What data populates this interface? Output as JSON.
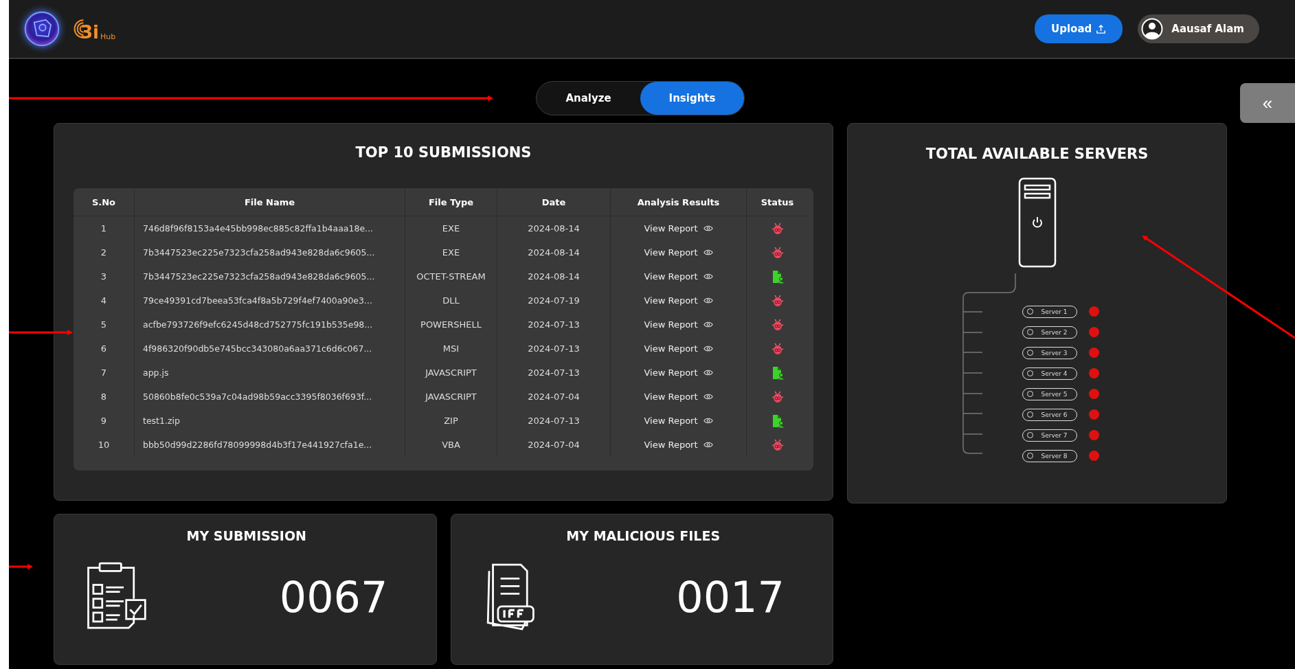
{
  "header": {
    "brand": "3i",
    "brand_sub": "Hub",
    "upload_button": "Upload",
    "user_name": "Aausaf Alam"
  },
  "tabs": [
    {
      "label": "Analyze",
      "selected": false
    },
    {
      "label": "Insights",
      "selected": true
    }
  ],
  "collapse_button": "«",
  "submissions": {
    "title": "TOP 10 SUBMISSIONS",
    "columns": [
      "S.No",
      "File Name",
      "File Type",
      "Date",
      "Analysis Results",
      "Status"
    ],
    "rows": [
      {
        "sno": "1",
        "file_name": "746d8f96f8153a4e45bb998ec885c82ffa1b4aaa18e...",
        "file_type": "EXE",
        "date": "2024-08-14",
        "result": "View Report",
        "kind": "malicious"
      },
      {
        "sno": "2",
        "file_name": "7b3447523ec225e7323cfa258ad943e828da6c9605...",
        "file_type": "EXE",
        "date": "2024-08-14",
        "result": "View Report",
        "kind": "malicious"
      },
      {
        "sno": "3",
        "file_name": "7b3447523ec225e7323cfa258ad943e828da6c9605...",
        "file_type": "OCTET-STREAM",
        "date": "2024-08-14",
        "result": "View Report",
        "kind": "clean"
      },
      {
        "sno": "4",
        "file_name": "79ce49391cd7beea53fca4f8a5b729f4ef7400a90e3...",
        "file_type": "DLL",
        "date": "2024-07-19",
        "result": "View Report",
        "kind": "malicious"
      },
      {
        "sno": "5",
        "file_name": "acfbe793726f9efc6245d48cd752775fc191b535e98...",
        "file_type": "POWERSHELL",
        "date": "2024-07-13",
        "result": "View Report",
        "kind": "malicious"
      },
      {
        "sno": "6",
        "file_name": "4f986320f90db5e745bcc343080a6aa371c6d6c067...",
        "file_type": "MSI",
        "date": "2024-07-13",
        "result": "View Report",
        "kind": "malicious"
      },
      {
        "sno": "7",
        "file_name": "app.js",
        "file_type": "JAVASCRIPT",
        "date": "2024-07-13",
        "result": "View Report",
        "kind": "clean"
      },
      {
        "sno": "8",
        "file_name": "50860b8fe0c539a7c04ad98b59acc3395f8036f693f...",
        "file_type": "JAVASCRIPT",
        "date": "2024-07-04",
        "result": "View Report",
        "kind": "malicious"
      },
      {
        "sno": "9",
        "file_name": "test1.zip",
        "file_type": "ZIP",
        "date": "2024-07-13",
        "result": "View Report",
        "kind": "clean"
      },
      {
        "sno": "10",
        "file_name": "bbb50d99d2286fd78099998d4b3f17e441927cfa1e...",
        "file_type": "VBA",
        "date": "2024-07-04",
        "result": "View Report",
        "kind": "malicious"
      }
    ]
  },
  "servers": {
    "title": "TOTAL AVAILABLE SERVERS",
    "items": [
      {
        "label": "Server 1",
        "online": false
      },
      {
        "label": "Server 2",
        "online": false
      },
      {
        "label": "Server 3",
        "online": false
      },
      {
        "label": "Server 4",
        "online": false
      },
      {
        "label": "Server 5",
        "online": false
      },
      {
        "label": "Server 6",
        "online": false
      },
      {
        "label": "Server 7",
        "online": false
      },
      {
        "label": "Server 8",
        "online": false
      }
    ]
  },
  "stats": [
    {
      "kind": "submissions",
      "title": "MY SUBMISSION",
      "value": "0067"
    },
    {
      "kind": "malicious",
      "title": "MY MALICIOUS FILES",
      "value": "0017"
    }
  ]
}
